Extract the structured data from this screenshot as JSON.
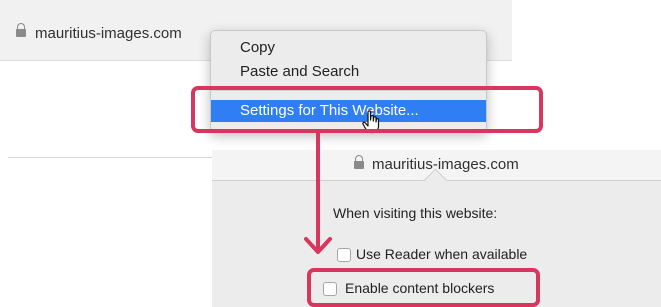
{
  "address_bar": {
    "url": "mauritius-images.com",
    "lock_icon": "lock-icon"
  },
  "context_menu": {
    "items": [
      {
        "label": "Copy"
      },
      {
        "label": "Paste and Search"
      },
      {
        "label": "Settings for This Website..."
      }
    ],
    "selected_index": 2
  },
  "website_settings": {
    "domain": "mauritius-images.com",
    "heading": "When visiting this website:",
    "options": [
      {
        "label": "Use Reader when available",
        "checked": false
      },
      {
        "label": "Enable content blockers",
        "checked": false
      }
    ]
  },
  "annotation": {
    "color": "#d8355f",
    "icons": [
      "hand-pointer-cursor-icon",
      "down-arrow-icon"
    ]
  },
  "colors": {
    "menu_highlight": "#2f7ef3",
    "annotation": "#d8355f"
  }
}
